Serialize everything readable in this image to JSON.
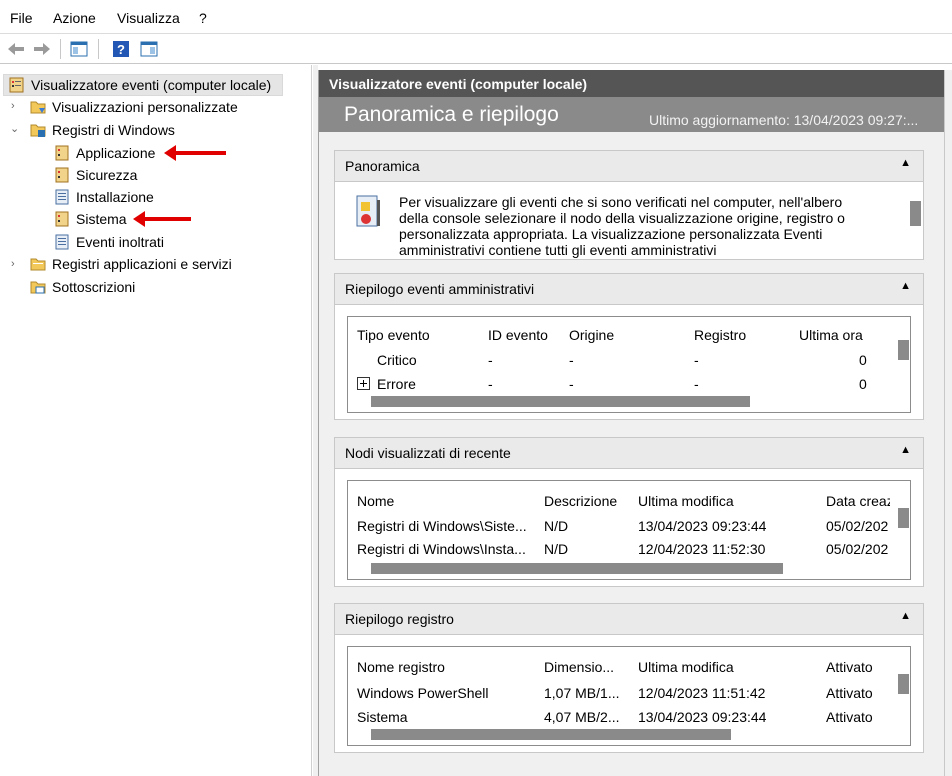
{
  "menu": {
    "file": "File",
    "action": "Azione",
    "view": "Visualizza",
    "help": "?"
  },
  "tree": {
    "root": "Visualizzatore eventi (computer locale)",
    "custom_views": "Visualizzazioni personalizzate",
    "windows_logs": "Registri di Windows",
    "app": "Applicazione",
    "security": "Sicurezza",
    "setup": "Installazione",
    "system": "Sistema",
    "forwarded": "Eventi inoltrati",
    "apps_services": "Registri applicazioni e servizi",
    "subscriptions": "Sottoscrizioni"
  },
  "right": {
    "header": "Visualizzatore eventi (computer locale)",
    "banner_title": "Panoramica e riepilogo",
    "banner_updated": "Ultimo aggiornamento: 13/04/2023 09:27:..."
  },
  "overview": {
    "title": "Panoramica",
    "text1": "Per visualizzare gli eventi che si sono verificati nel computer, nell'albero",
    "text2": "della console selezionare il nodo della visualizzazione origine, registro o",
    "text3": "personalizzata appropriata. La visualizzazione personalizzata Eventi",
    "text4": "amministrativi contiene tutti gli eventi amministrativi"
  },
  "admin_summary": {
    "title": "Riepilogo eventi amministrativi",
    "headers": [
      "Tipo evento",
      "ID evento",
      "Origine",
      "Registro",
      "Ultima ora"
    ],
    "rows": [
      [
        "Critico",
        "-",
        "-",
        "-",
        "0"
      ],
      [
        "Errore",
        "-",
        "-",
        "-",
        "0"
      ]
    ]
  },
  "recent_nodes": {
    "title": "Nodi visualizzati di recente",
    "headers": [
      "Nome",
      "Descrizione",
      "Ultima modifica",
      "Data creaz"
    ],
    "rows": [
      [
        "Registri di Windows\\Siste...",
        "N/D",
        "13/04/2023 09:23:44",
        "05/02/202"
      ],
      [
        "Registri di Windows\\Insta...",
        "N/D",
        "12/04/2023 11:52:30",
        "05/02/202"
      ]
    ]
  },
  "log_summary": {
    "title": "Riepilogo registro",
    "headers": [
      "Nome registro",
      "Dimensio...",
      "Ultima modifica",
      "Attivato"
    ],
    "rows": [
      [
        "Windows PowerShell",
        "1,07 MB/1...",
        "12/04/2023 11:51:42",
        "Attivato"
      ],
      [
        "Sistema",
        "4,07 MB/2...",
        "13/04/2023 09:23:44",
        "Attivato"
      ]
    ]
  },
  "colors": {
    "annotation_arrow": "#e00000",
    "panel_header": "#555555",
    "banner": "#8a8a8a"
  },
  "icons": [
    "back-arrow-icon",
    "forward-arrow-icon",
    "console-tree-icon",
    "help-icon",
    "action-pane-icon",
    "event-log-icon",
    "folder-icon",
    "log-icon",
    "subscription-icon",
    "expand-plus-icon",
    "collapse-chevron-icon"
  ]
}
